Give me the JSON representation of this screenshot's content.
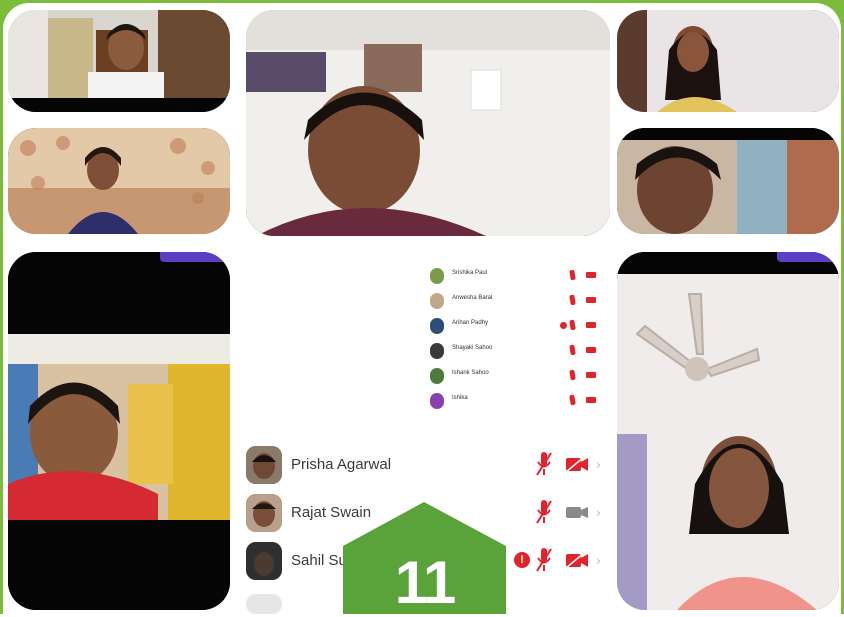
{
  "page_number": "11",
  "colors": {
    "frame_green": "#7dbb3a",
    "badge_green": "#5aa23a",
    "alert_red": "#e0242c",
    "tab_purple": "#5b3fc4"
  },
  "panel": {
    "mini_participants": [
      {
        "name": "Srishika Paul",
        "muted": true,
        "camera_off": true,
        "alert": false
      },
      {
        "name": "Anwesha Baral",
        "muted": true,
        "camera_off": true,
        "alert": false
      },
      {
        "name": "Arihan Padhy",
        "muted": true,
        "camera_off": true,
        "alert": true
      },
      {
        "name": "Shayaki Sahoo",
        "muted": true,
        "camera_off": true,
        "alert": false
      },
      {
        "name": "Ishank Sahoo",
        "muted": true,
        "camera_off": true,
        "alert": false
      },
      {
        "name": "Ishika",
        "muted": true,
        "camera_off": true,
        "alert": false
      }
    ],
    "participants": [
      {
        "name": "Prisha Agarwal",
        "icons": [
          "mic-muted-icon",
          "camera-off-icon",
          "chevron-right-icon"
        ]
      },
      {
        "name": "Rajat Swain",
        "icons": [
          "mic-muted-icon",
          "camera-icon",
          "chevron-right-icon"
        ]
      },
      {
        "name": "Sahil Su",
        "icons": [
          "alert-icon",
          "mic-muted-icon",
          "camera-off-icon",
          "chevron-right-icon"
        ]
      }
    ],
    "alert_glyph": "!",
    "chevron_glyph": "›"
  }
}
